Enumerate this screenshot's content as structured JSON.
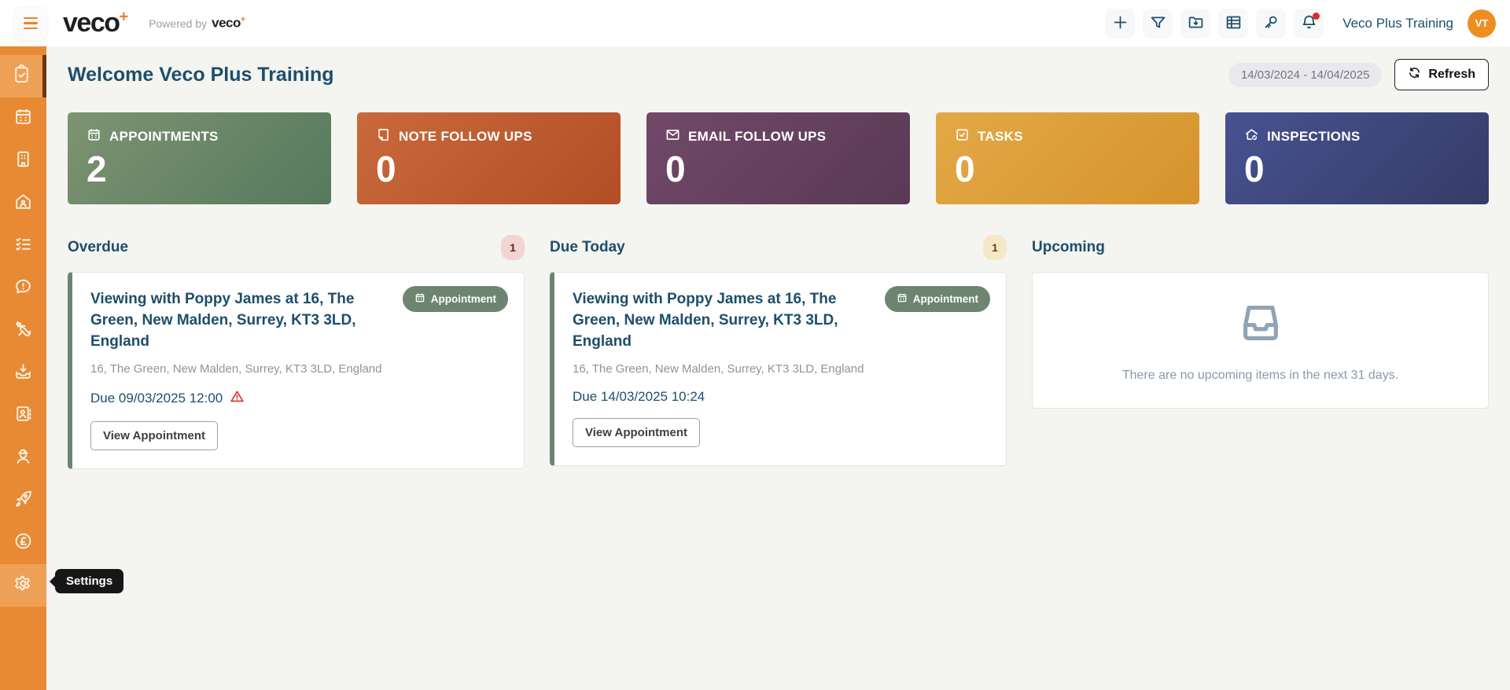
{
  "header": {
    "brand": "veco",
    "brand_plus": "+",
    "powered_by_text": "Powered by",
    "powered_brand": "veco",
    "powered_plus": "+",
    "action_icons": [
      "plus-icon",
      "filter-icon",
      "folder-export-icon",
      "table-icon",
      "key-icon",
      "bell-icon"
    ],
    "has_notification_dot": true,
    "user_name": "Veco Plus Training",
    "avatar_initials": "VT",
    "icon_color": "#1d4e6b",
    "avatar_color": "#ee8e20"
  },
  "sidebar": {
    "color": "#e78a33",
    "active_item_color": "#efa057",
    "active_border_color": "#6e3410",
    "items": [
      {
        "icon": "clipboard-check-icon",
        "state": "active"
      },
      {
        "icon": "calendar-icon",
        "state": "normal"
      },
      {
        "icon": "building-icon",
        "state": "normal"
      },
      {
        "icon": "house-person-icon",
        "state": "normal"
      },
      {
        "icon": "checklist-icon",
        "state": "normal"
      },
      {
        "icon": "chat-alert-icon",
        "state": "normal"
      },
      {
        "icon": "tools-icon",
        "state": "normal"
      },
      {
        "icon": "download-tray-icon",
        "state": "normal"
      },
      {
        "icon": "contact-card-icon",
        "state": "normal"
      },
      {
        "icon": "worker-icon",
        "state": "normal"
      },
      {
        "icon": "rocket-icon",
        "state": "normal"
      },
      {
        "icon": "pound-circle-icon",
        "state": "normal"
      },
      {
        "icon": "gear-icon",
        "state": "hovered"
      }
    ],
    "tooltip_label": "Settings"
  },
  "page": {
    "title": "Welcome Veco Plus Training",
    "date_range": "14/03/2024 - 14/04/2025",
    "refresh_label": "Refresh"
  },
  "stats": [
    {
      "label": "APPOINTMENTS",
      "value": "2",
      "icon": "calendar-icon",
      "color_from": "#7d9471",
      "color_to": "#56795e"
    },
    {
      "label": "NOTE FOLLOW UPS",
      "value": "0",
      "icon": "note-icon",
      "color_from": "#c96a3b",
      "color_to": "#b24e26"
    },
    {
      "label": "EMAIL FOLLOW UPS",
      "value": "0",
      "icon": "envelope-icon",
      "color_from": "#714969",
      "color_to": "#593a54"
    },
    {
      "label": "TASKS",
      "value": "0",
      "icon": "task-check-icon",
      "color_from": "#e3a946",
      "color_to": "#d5932c"
    },
    {
      "label": "INSPECTIONS",
      "value": "0",
      "icon": "house-check-icon",
      "color_from": "#475290",
      "color_to": "#363c68"
    }
  ],
  "columns": {
    "overdue": {
      "heading": "Overdue",
      "count": "1",
      "badge_bg": "#f2d4d0",
      "card": {
        "title": "Viewing with Poppy James at 16, The Green, New Malden, Surrey, KT3 3LD, England",
        "badge": "Appointment",
        "badge_color": "#6d8471",
        "address": "16, The Green, New Malden, Surrey, KT3 3LD, England",
        "due": "Due 09/03/2025 12:00",
        "has_warning": true,
        "button_label": "View Appointment"
      }
    },
    "due_today": {
      "heading": "Due Today",
      "count": "1",
      "badge_bg": "#f5e8c8",
      "card": {
        "title": "Viewing with Poppy James at 16, The Green, New Malden, Surrey, KT3 3LD, England",
        "badge": "Appointment",
        "badge_color": "#6d8471",
        "address": "16, The Green, New Malden, Surrey, KT3 3LD, England",
        "due": "Due 14/03/2025 10:24",
        "has_warning": false,
        "button_label": "View Appointment"
      }
    },
    "upcoming": {
      "heading": "Upcoming",
      "empty_icon": "inbox-icon",
      "empty_text": "There are no upcoming items in the next 31 days."
    }
  }
}
